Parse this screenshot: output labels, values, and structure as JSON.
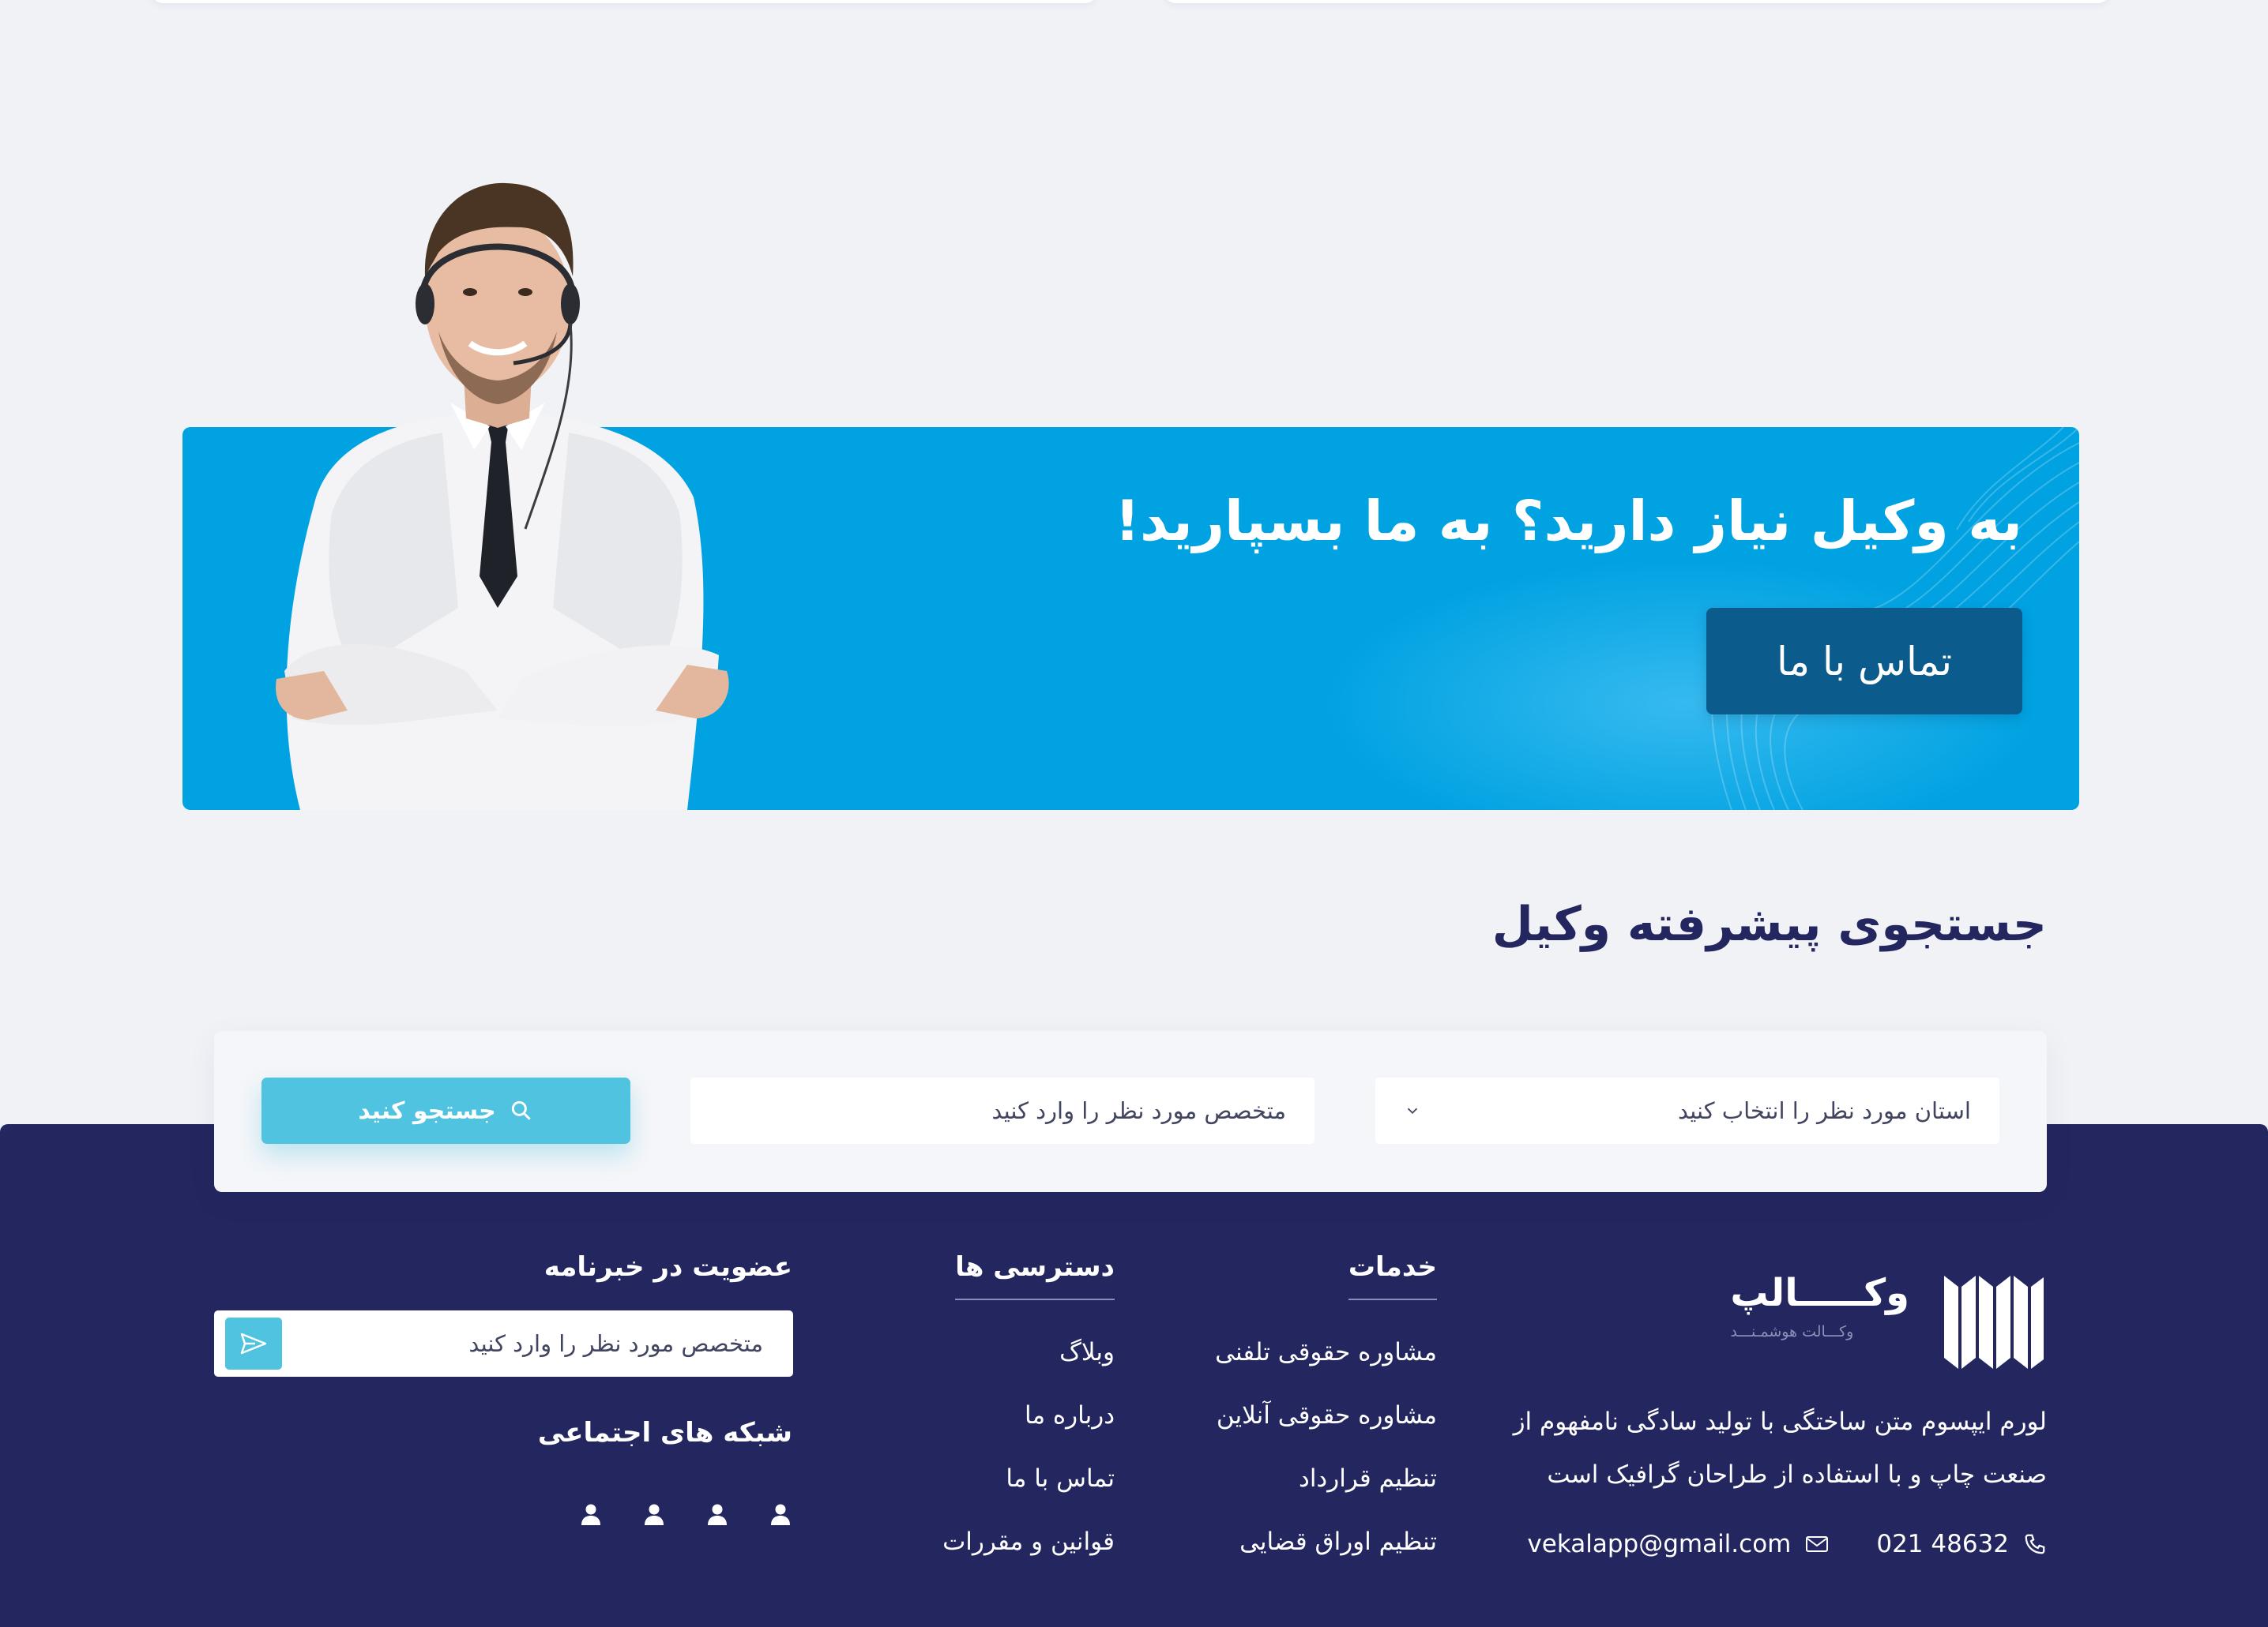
{
  "banner": {
    "title": "به وکیل نیاز دارید؟ به ما بسپارید!",
    "button_label": "تماس با ما"
  },
  "search": {
    "title": "جستجوی پیشرفته وکیل",
    "province_placeholder": "استان مورد نظر را انتخاب کنید",
    "specialist_placeholder": "متخصص مورد نظر را وارد کنید",
    "button_label": "جستجو کنید"
  },
  "footer": {
    "logo_name": "وکـــــالپ",
    "logo_tagline": "وکـــالت هوشمـنـــد",
    "about": "لورم ایپسوم متن ساختگی با تولید سادگی نامفهوم از صنعت چاپ و با استفاده از طراحان گرافیک است",
    "phone": "021 48632",
    "email": "vekalapp@gmail.com",
    "services": {
      "title": "خدمات",
      "items": [
        "مشاوره حقوقی تلفنی",
        "مشاوره حقوقی آنلاین",
        "تنظیم قرارداد",
        "تنظیم اوراق قضایی"
      ]
    },
    "access": {
      "title": "دسترسی ها",
      "items": [
        "وبلاگ",
        "درباره ما",
        "تماس با ما",
        "قوانین و مقررات"
      ]
    },
    "newsletter": {
      "title": "عضویت در خبرنامه",
      "placeholder": "متخصص مورد نظر را وارد کنید"
    },
    "social": {
      "title": "شبکه های اجتماعی",
      "icons": [
        "user-icon",
        "user-icon",
        "user-icon",
        "user-icon"
      ]
    }
  },
  "colors": {
    "banner": "#00a2e2",
    "button_dark": "#0b5b8c",
    "footer": "#24265f",
    "accent": "#4fc3e0",
    "page_bg": "#f0f2f6"
  }
}
